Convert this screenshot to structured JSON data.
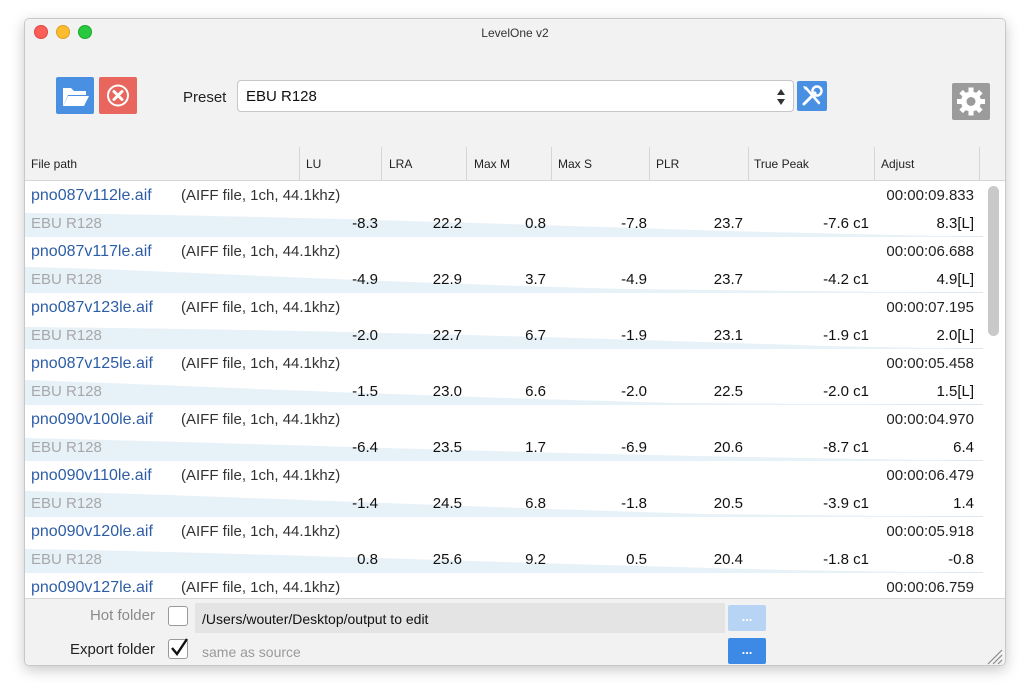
{
  "window": {
    "title": "LevelOne v2"
  },
  "toolbar": {
    "open_icon": "folder-open-icon",
    "remove_icon": "remove-circle-icon",
    "preset_label": "Preset",
    "preset_value": "EBU R128",
    "tools_icon": "wrench-screwdriver-icon",
    "settings_icon": "gear-icon"
  },
  "columns": [
    "File path",
    "LU",
    "LRA",
    "Max M",
    "Max S",
    "PLR",
    "True Peak",
    "Adjust"
  ],
  "rows": [
    {
      "name": "pno087v112le.aif",
      "type": "(AIFF file, 1ch, 44.1khz)",
      "duration": "00:00:09.833",
      "preset": "EBU R128",
      "lu": "-8.3",
      "lra": "22.2",
      "maxm": "0.8",
      "maxs": "-7.8",
      "plr": "23.7",
      "tp": "-7.6 c1",
      "adjust": "8.3[L]"
    },
    {
      "name": "pno087v117le.aif",
      "type": "(AIFF file, 1ch, 44.1khz)",
      "duration": "00:00:06.688",
      "preset": "EBU R128",
      "lu": "-4.9",
      "lra": "22.9",
      "maxm": "3.7",
      "maxs": "-4.9",
      "plr": "23.7",
      "tp": "-4.2 c1",
      "adjust": "4.9[L]"
    },
    {
      "name": "pno087v123le.aif",
      "type": "(AIFF file, 1ch, 44.1khz)",
      "duration": "00:00:07.195",
      "preset": "EBU R128",
      "lu": "-2.0",
      "lra": "22.7",
      "maxm": "6.7",
      "maxs": "-1.9",
      "plr": "23.1",
      "tp": "-1.9 c1",
      "adjust": "2.0[L]"
    },
    {
      "name": "pno087v125le.aif",
      "type": "(AIFF file, 1ch, 44.1khz)",
      "duration": "00:00:05.458",
      "preset": "EBU R128",
      "lu": "-1.5",
      "lra": "23.0",
      "maxm": "6.6",
      "maxs": "-2.0",
      "plr": "22.5",
      "tp": "-2.0 c1",
      "adjust": "1.5[L]"
    },
    {
      "name": "pno090v100le.aif",
      "type": "(AIFF file, 1ch, 44.1khz)",
      "duration": "00:00:04.970",
      "preset": "EBU R128",
      "lu": "-6.4",
      "lra": "23.5",
      "maxm": "1.7",
      "maxs": "-6.9",
      "plr": "20.6",
      "tp": "-8.7 c1",
      "adjust": "6.4"
    },
    {
      "name": "pno090v110le.aif",
      "type": "(AIFF file, 1ch, 44.1khz)",
      "duration": "00:00:06.479",
      "preset": "EBU R128",
      "lu": "-1.4",
      "lra": "24.5",
      "maxm": "6.8",
      "maxs": "-1.8",
      "plr": "20.5",
      "tp": "-3.9 c1",
      "adjust": "1.4"
    },
    {
      "name": "pno090v120le.aif",
      "type": "(AIFF file, 1ch, 44.1khz)",
      "duration": "00:00:05.918",
      "preset": "EBU R128",
      "lu": "0.8",
      "lra": "25.6",
      "maxm": "9.2",
      "maxs": "0.5",
      "plr": "20.4",
      "tp": "-1.8 c1",
      "adjust": "-0.8"
    },
    {
      "name": "pno090v127le.aif",
      "type": "(AIFF file, 1ch, 44.1khz)",
      "duration": "00:00:06.759",
      "preset": "",
      "lu": "",
      "lra": "",
      "maxm": "",
      "maxs": "",
      "plr": "",
      "tp": "",
      "adjust": ""
    }
  ],
  "footer": {
    "hot_folder_label": "Hot folder",
    "hot_folder_checked": false,
    "hot_folder_path": "/Users/wouter/Desktop/output to edit",
    "hot_folder_button": "...",
    "export_folder_label": "Export folder",
    "export_folder_checked": true,
    "export_folder_placeholder": "same as source",
    "export_folder_button": "..."
  }
}
